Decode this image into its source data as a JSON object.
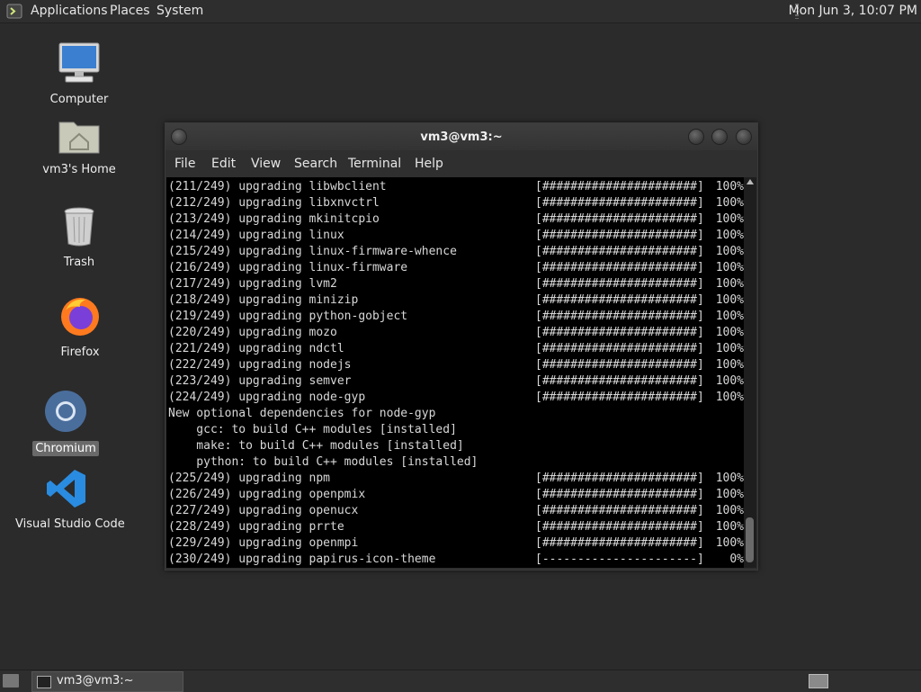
{
  "top_panel": {
    "menu": [
      "Applications",
      "Places",
      "System"
    ],
    "clock": "Mon Jun  3, 10:07 PM"
  },
  "desktop_icons": [
    {
      "label": "Computer",
      "icon": "computer-icon"
    },
    {
      "label": "vm3's Home",
      "icon": "home-folder-icon"
    },
    {
      "label": "Trash",
      "icon": "trash-icon"
    },
    {
      "label": "Firefox",
      "icon": "firefox-icon"
    },
    {
      "label": "Chromium",
      "icon": "chromium-icon",
      "selected": true
    },
    {
      "label": "Visual Studio Code",
      "icon": "vscode-icon"
    }
  ],
  "window": {
    "title": "vm3@vm3:~",
    "menu": [
      "File",
      "Edit",
      "View",
      "Search",
      "Terminal",
      "Help"
    ]
  },
  "terminal": {
    "lines": [
      {
        "text": "(211/249) upgrading libwbclient",
        "bar": "[######################]",
        "pct": "100%"
      },
      {
        "text": "(212/249) upgrading libxnvctrl",
        "bar": "[######################]",
        "pct": "100%"
      },
      {
        "text": "(213/249) upgrading mkinitcpio",
        "bar": "[######################]",
        "pct": "100%"
      },
      {
        "text": "(214/249) upgrading linux",
        "bar": "[######################]",
        "pct": "100%"
      },
      {
        "text": "(215/249) upgrading linux-firmware-whence",
        "bar": "[######################]",
        "pct": "100%"
      },
      {
        "text": "(216/249) upgrading linux-firmware",
        "bar": "[######################]",
        "pct": "100%"
      },
      {
        "text": "(217/249) upgrading lvm2",
        "bar": "[######################]",
        "pct": "100%"
      },
      {
        "text": "(218/249) upgrading minizip",
        "bar": "[######################]",
        "pct": "100%"
      },
      {
        "text": "(219/249) upgrading python-gobject",
        "bar": "[######################]",
        "pct": "100%"
      },
      {
        "text": "(220/249) upgrading mozo",
        "bar": "[######################]",
        "pct": "100%"
      },
      {
        "text": "(221/249) upgrading ndctl",
        "bar": "[######################]",
        "pct": "100%"
      },
      {
        "text": "(222/249) upgrading nodejs",
        "bar": "[######################]",
        "pct": "100%"
      },
      {
        "text": "(223/249) upgrading semver",
        "bar": "[######################]",
        "pct": "100%"
      },
      {
        "text": "(224/249) upgrading node-gyp",
        "bar": "[######################]",
        "pct": "100%"
      },
      {
        "text": "New optional dependencies for node-gyp"
      },
      {
        "text": "    gcc: to build C++ modules [installed]"
      },
      {
        "text": "    make: to build C++ modules [installed]"
      },
      {
        "text": "    python: to build C++ modules [installed]"
      },
      {
        "text": "(225/249) upgrading npm",
        "bar": "[######################]",
        "pct": "100%"
      },
      {
        "text": "(226/249) upgrading openpmix",
        "bar": "[######################]",
        "pct": "100%"
      },
      {
        "text": "(227/249) upgrading openucx",
        "bar": "[######################]",
        "pct": "100%"
      },
      {
        "text": "(228/249) upgrading prrte",
        "bar": "[######################]",
        "pct": "100%"
      },
      {
        "text": "(229/249) upgrading openmpi",
        "bar": "[######################]",
        "pct": "100%"
      },
      {
        "text": "(230/249) upgrading papirus-icon-theme",
        "bar": "[----------------------]",
        "pct": "0%"
      }
    ]
  },
  "taskbar": {
    "task_label": "vm3@vm3:~"
  }
}
